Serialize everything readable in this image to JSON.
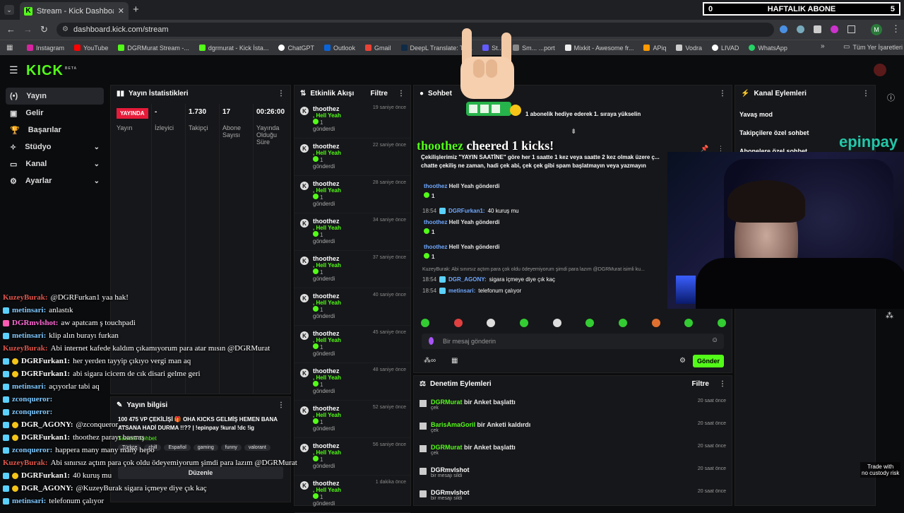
{
  "overlay": {
    "weekly_count": "0",
    "weekly_label": "HAFTALIK ABONE",
    "weekly_right": "5",
    "cheer_user": "thoothez",
    "cheer_text": "cheered 1 kicks!",
    "epin_brand": "epinpay",
    "trade_line1": "Trade with",
    "trade_line2": "no custody risk"
  },
  "browser": {
    "tab_title": "Stream - Kick Dashboard",
    "url": "dashboard.kick.com/stream",
    "bookmarks": [
      "Instagram",
      "YouTube",
      "DGRMurat Stream -...",
      "dgrmurat - Kick İsta...",
      "ChatGPT",
      "Outlook",
      "Gmail",
      "DeepL Translate: Th...",
      "St...",
      "Sm... ...port",
      "Mixkit - Awesome fr...",
      "APiq",
      "Vodra",
      "LIVAD",
      "WhatsApp"
    ],
    "all_bookmarks": "Tüm Yer İşaretleri",
    "profile_letter": "M"
  },
  "brand": {
    "logo": "KICK",
    "beta": "BETA"
  },
  "sidebar": {
    "items": [
      {
        "label": "Yayın",
        "icon": "broadcast-icon"
      },
      {
        "label": "Gelir",
        "icon": "revenue-icon"
      },
      {
        "label": "Başarılar",
        "icon": "trophy-icon"
      },
      {
        "label": "Stüdyo",
        "icon": "studio-icon"
      },
      {
        "label": "Kanal",
        "icon": "channel-icon"
      },
      {
        "label": "Ayarlar",
        "icon": "gear-icon"
      }
    ]
  },
  "stats": {
    "title": "Yayın İstatistikleri",
    "live_badge": "YAYINDA",
    "cols": [
      {
        "value": "",
        "label": "Yayın"
      },
      {
        "value": "-",
        "label": "İzleyici"
      },
      {
        "value": "1.730",
        "label": "Takipçi"
      },
      {
        "value": "17",
        "label": "Abone Sayısı"
      },
      {
        "value": "00:26:00",
        "label": "Yayında Olduğu Süre"
      }
    ]
  },
  "info": {
    "title": "Yayın bilgisi",
    "text": "100 475 VP ÇEKİLİŞİ 🎁 OHA KICKS GELMİŞ HEMEN BANA ATSANA HADİ DURMA !!?? | !epinpay !kural !dc !ig",
    "tags": [
      "Türkçe",
      "chill",
      "Español",
      "gaming",
      "funny",
      "valorant"
    ],
    "edit": "Düzenle",
    "sub_only": "Sadece Sohbet"
  },
  "activity": {
    "title": "Etkinlik Akışı",
    "filter": "Filtre",
    "events": [
      {
        "user": "thoothez",
        "item": "Hell Yeah",
        "count": "1",
        "action": "gönderdi",
        "time": "19 saniye önce"
      },
      {
        "user": "thoothez",
        "item": "Hell Yeah",
        "count": "1",
        "action": "gönderdi",
        "time": "22 saniye önce"
      },
      {
        "user": "thoothez",
        "item": "Hell Yeah",
        "count": "1",
        "action": "gönderdi",
        "time": "28 saniye önce"
      },
      {
        "user": "thoothez",
        "item": "Hell Yeah",
        "count": "1",
        "action": "gönderdi",
        "time": "34 saniye önce"
      },
      {
        "user": "thoothez",
        "item": "Hell Yeah",
        "count": "1",
        "action": "gönderdi",
        "time": "37 saniye önce"
      },
      {
        "user": "thoothez",
        "item": "Hell Yeah",
        "count": "1",
        "action": "gönderdi",
        "time": "40 saniye önce"
      },
      {
        "user": "thoothez",
        "item": "Hell Yeah",
        "count": "1",
        "action": "gönderdi",
        "time": "45 saniye önce"
      },
      {
        "user": "thoothez",
        "item": "Hell Yeah",
        "count": "1",
        "action": "gönderdi",
        "time": "48 saniye önce"
      },
      {
        "user": "thoothez",
        "item": "Hell Yeah",
        "count": "1",
        "action": "gönderdi",
        "time": "52 saniye önce"
      },
      {
        "user": "thoothez",
        "item": "Hell Yeah",
        "count": "1",
        "action": "gönderdi",
        "time": "56 saniye önce"
      },
      {
        "user": "thoothez",
        "item": "Hell Yeah",
        "count": "1",
        "action": "gönderdi",
        "time": "1 dakika önce"
      }
    ]
  },
  "chat": {
    "title": "Sohbet",
    "gift_banner": "1 abonelik hediye ederek 1. sıraya yükselin",
    "pinned": "Çekilişlerimiz \"YAYIN SAATİNE\" göre her 1 saatte 1 kez veya saatte 2 kez olmak üzere ç... chatte çekiliş ne zaman, hadi çek abi, çek çek gibi spam başlatmayın veya yazmayın",
    "messages": [
      {
        "kind": "gift",
        "user": "thoothez",
        "text": "Hell Yeah gönderdi",
        "count": "1"
      },
      {
        "kind": "msg",
        "time": "18:54",
        "user": "DGRFurkan1:",
        "text": "40 kuruş mu"
      },
      {
        "kind": "gift",
        "user": "thoothez",
        "text": "Hell Yeah gönderdi",
        "count": "1"
      },
      {
        "kind": "gift",
        "user": "thoothez",
        "text": "Hell Yeah gönderdi",
        "count": "1"
      },
      {
        "kind": "reply",
        "text": "KuzeyBurak: Abi sınırsız açtım para çok oldu ödeyemiyorum şimdi para lazım @DGRMurat isimli ku..."
      },
      {
        "kind": "msg",
        "time": "18:54",
        "user": "DGR_AGONY:",
        "text": "sigara içmeye diye çık kaç"
      },
      {
        "kind": "msg",
        "time": "18:54",
        "user": "metinsari:",
        "text": "telefonum çalıyor"
      }
    ],
    "input_placeholder": "Bir mesaj gönderin",
    "send": "Gönder"
  },
  "modlog": {
    "title": "Denetim Eylemleri",
    "filter": "Filtre",
    "rows": [
      {
        "user": "DGRMurat",
        "action": "bir Anket başlattı",
        "sub": "çek",
        "time": "20 saat önce",
        "green": true
      },
      {
        "user": "BarisAmaGoril",
        "action": "bir Anketi kaldırdı",
        "sub": "çek",
        "time": "20 saat önce",
        "green": true
      },
      {
        "user": "DGRMurat",
        "action": "bir Anket başlattı",
        "sub": "çek",
        "time": "20 saat önce",
        "green": true
      },
      {
        "user": "DGRmvlshot",
        "action": "",
        "sub": "bir mesajı sildi",
        "time": "20 saat önce",
        "green": false
      },
      {
        "user": "DGRmvlshot",
        "action": "",
        "sub": "bir mesajı sildi",
        "time": "20 saat önce",
        "green": false
      }
    ]
  },
  "channel": {
    "title": "Kanal Eylemleri",
    "items": [
      "Yavaş mod",
      "Takipçilere özel sohbet",
      "Abonelere özel sohbet"
    ]
  },
  "overlay_chat": [
    {
      "color": "red",
      "user": "KuzeyBurak:",
      "text": "@DGRFurkan1 yaa hak!"
    },
    {
      "color": "blue",
      "user": "metinsari:",
      "text": "anlastık"
    },
    {
      "color": "pink",
      "user": "DGRmvlshot:",
      "text": "aw apatcam ş touchpadi"
    },
    {
      "color": "blue",
      "user": "metinsari:",
      "text": "klip alın burayı furkan"
    },
    {
      "color": "red",
      "user": "KuzeyBurak:",
      "text": "Abi internet kafede kaldım çıkamıyorum para atar mısın @DGRMurat"
    },
    {
      "color": "white",
      "user": "DGRFurkan1:",
      "text": "her yerden tayyip çıkıyo vergi man aq"
    },
    {
      "color": "white",
      "user": "DGRFurkan1:",
      "text": "abi sigara icicem de cık disari gelme geri"
    },
    {
      "color": "blue",
      "user": "metinsari:",
      "text": "açıyorlar tabi aq"
    },
    {
      "color": "blue",
      "user": "zconqueror:",
      "text": ""
    },
    {
      "color": "blue",
      "user": "zconqueror:",
      "text": ""
    },
    {
      "color": "white",
      "user": "DGR_AGONY:",
      "text": "@zconqueror ..."
    },
    {
      "color": "white",
      "user": "DGRFurkan1:",
      "text": "thoothez parayı basmış"
    },
    {
      "color": "blue",
      "user": "zconqueror:",
      "text": "happera many many many hepo"
    },
    {
      "color": "red",
      "user": "KuzeyBurak:",
      "text": "Abi sınırsız açtım para çok oldu ödeyemiyorum şimdi para lazım @DGRMurat"
    },
    {
      "color": "white",
      "user": "DGRFurkan1:",
      "text": "40 kuruş mu"
    },
    {
      "color": "white",
      "user": "DGR_AGONY:",
      "text": "@KuzeyBurak sigara içmeye diye çık kaç"
    },
    {
      "color": "blue",
      "user": "metinsari:",
      "text": "telefonum çalıyor"
    }
  ]
}
